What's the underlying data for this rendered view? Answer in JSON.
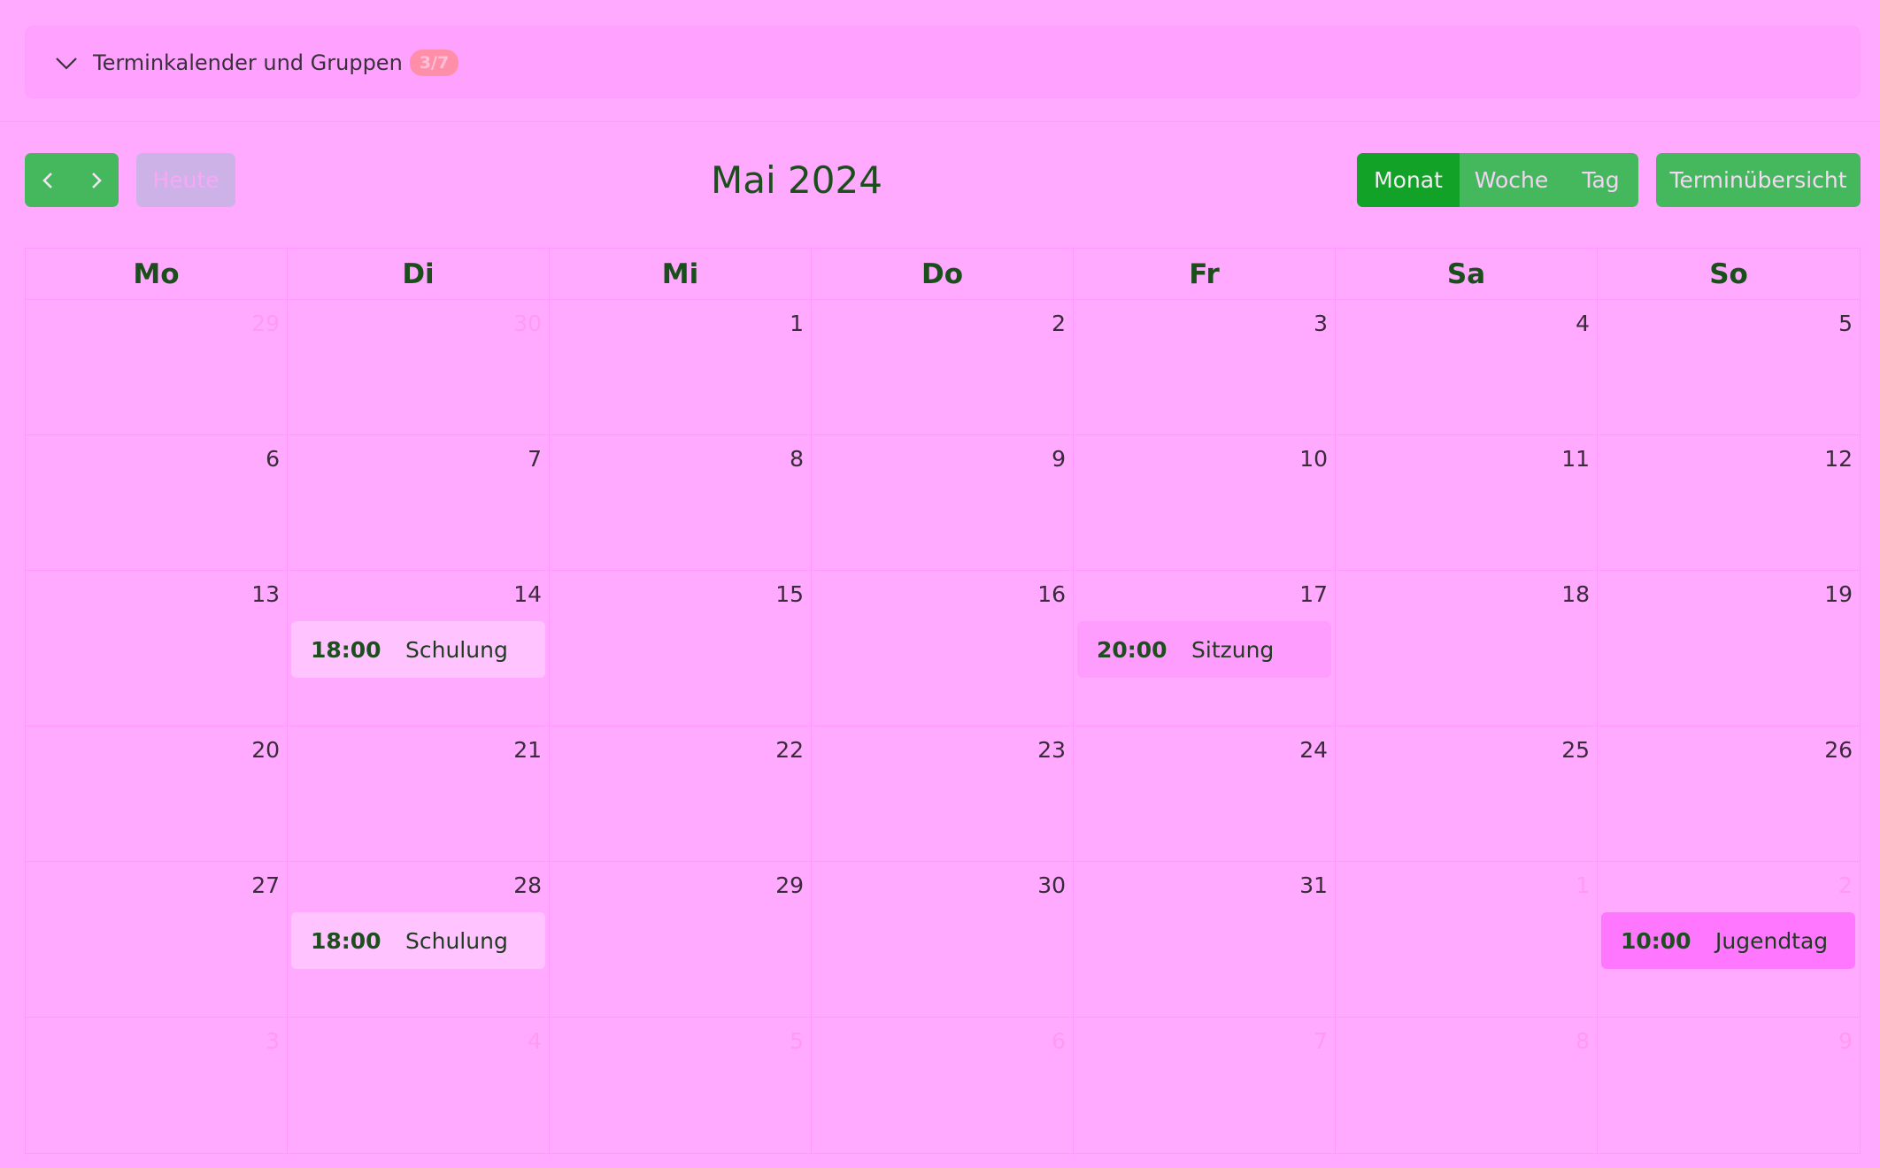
{
  "panel": {
    "title": "Terminkalender und Gruppen",
    "badge": "3/7"
  },
  "toolbar": {
    "today_label": "Heute",
    "title": "Mai 2024",
    "views": [
      "Monat",
      "Woche",
      "Tag"
    ],
    "active_view": "Monat",
    "overview_label": "Terminübersicht"
  },
  "weekdays": [
    "Mo",
    "Di",
    "Mi",
    "Do",
    "Fr",
    "Sa",
    "So"
  ],
  "weeks": [
    [
      {
        "d": "29",
        "m": true
      },
      {
        "d": "30",
        "m": true
      },
      {
        "d": "1"
      },
      {
        "d": "2"
      },
      {
        "d": "3"
      },
      {
        "d": "4"
      },
      {
        "d": "5"
      }
    ],
    [
      {
        "d": "6"
      },
      {
        "d": "7"
      },
      {
        "d": "8"
      },
      {
        "d": "9"
      },
      {
        "d": "10"
      },
      {
        "d": "11"
      },
      {
        "d": "12"
      }
    ],
    [
      {
        "d": "13"
      },
      {
        "d": "14"
      },
      {
        "d": "15"
      },
      {
        "d": "16"
      },
      {
        "d": "17"
      },
      {
        "d": "18"
      },
      {
        "d": "19"
      }
    ],
    [
      {
        "d": "20"
      },
      {
        "d": "21"
      },
      {
        "d": "22"
      },
      {
        "d": "23"
      },
      {
        "d": "24"
      },
      {
        "d": "25"
      },
      {
        "d": "26"
      }
    ],
    [
      {
        "d": "27"
      },
      {
        "d": "28"
      },
      {
        "d": "29"
      },
      {
        "d": "30"
      },
      {
        "d": "31"
      },
      {
        "d": "1",
        "m": true
      },
      {
        "d": "2",
        "m": true
      }
    ],
    [
      {
        "d": "3",
        "m": true
      },
      {
        "d": "4",
        "m": true
      },
      {
        "d": "5",
        "m": true
      },
      {
        "d": "6",
        "m": true
      },
      {
        "d": "7",
        "m": true
      },
      {
        "d": "8",
        "m": true
      },
      {
        "d": "9",
        "m": true
      }
    ]
  ],
  "events": [
    {
      "week": 2,
      "day": 1,
      "time": "18:00",
      "title": "Schulung",
      "style": "light"
    },
    {
      "week": 2,
      "day": 4,
      "time": "20:00",
      "title": "Sitzung",
      "style": "mid"
    },
    {
      "week": 4,
      "day": 1,
      "time": "18:00",
      "title": "Schulung",
      "style": "light"
    },
    {
      "week": 4,
      "day": 6,
      "time": "10:00",
      "title": "Jugendtag",
      "style": "strong"
    }
  ]
}
